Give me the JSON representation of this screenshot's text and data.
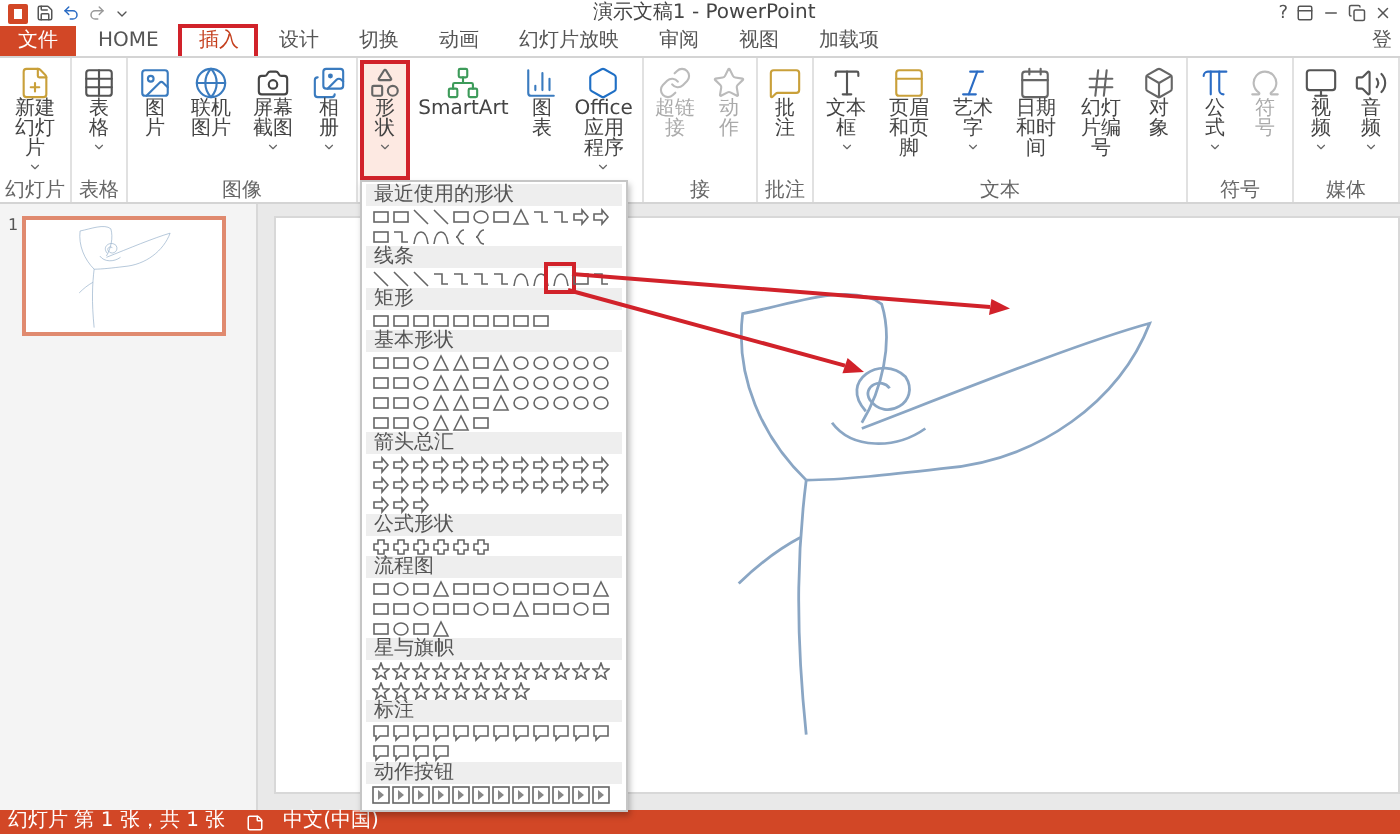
{
  "title_bar": {
    "title": "演示文稿1 - PowerPoint",
    "help": "?"
  },
  "tabs": [
    {
      "label": "文件",
      "kind": "file",
      "selected": false,
      "highlighted": false
    },
    {
      "label": "HOME",
      "kind": "tab",
      "selected": false,
      "highlighted": false
    },
    {
      "label": "插入",
      "kind": "tab",
      "selected": true,
      "highlighted": true
    },
    {
      "label": "设计",
      "kind": "tab",
      "selected": false,
      "highlighted": false
    },
    {
      "label": "切换",
      "kind": "tab",
      "selected": false,
      "highlighted": false
    },
    {
      "label": "动画",
      "kind": "tab",
      "selected": false,
      "highlighted": false
    },
    {
      "label": "幻灯片放映",
      "kind": "tab",
      "selected": false,
      "highlighted": false
    },
    {
      "label": "审阅",
      "kind": "tab",
      "selected": false,
      "highlighted": false
    },
    {
      "label": "视图",
      "kind": "tab",
      "selected": false,
      "highlighted": false
    },
    {
      "label": "加载项",
      "kind": "tab",
      "selected": false,
      "highlighted": false
    }
  ],
  "account": "登",
  "ribbon": [
    {
      "label": "幻灯片",
      "buttons": [
        {
          "label": "新建幻灯片",
          "caret": true,
          "disabled": false,
          "highlighted": false
        }
      ]
    },
    {
      "label": "表格",
      "buttons": [
        {
          "label": "表格",
          "caret": true,
          "disabled": false,
          "highlighted": false
        }
      ]
    },
    {
      "label": "图像",
      "buttons": [
        {
          "label": "图片",
          "caret": false,
          "disabled": false,
          "highlighted": false
        },
        {
          "label": "联机图片",
          "caret": false,
          "disabled": false,
          "highlighted": false
        },
        {
          "label": "屏幕截图",
          "caret": true,
          "disabled": false,
          "highlighted": false
        },
        {
          "label": "相册",
          "caret": true,
          "disabled": false,
          "highlighted": false
        }
      ]
    },
    {
      "buttons": [
        {
          "label": "形状",
          "caret": true,
          "disabled": false,
          "highlighted": true,
          "menu": {
            "sections": [
              {
                "title": "最近使用的形状",
                "kind": "recent",
                "highlighted": false
              },
              {
                "title": "线条",
                "kind": "lines",
                "highlighted": true
              },
              {
                "title": "矩形",
                "kind": "rectangles",
                "highlighted": false
              },
              {
                "title": "基本形状",
                "kind": "basic",
                "highlighted": false
              },
              {
                "title": "箭头总汇",
                "kind": "arrows",
                "highlighted": false
              },
              {
                "title": "公式形状",
                "kind": "equation",
                "highlighted": false
              },
              {
                "title": "流程图",
                "kind": "flowchart",
                "highlighted": false
              },
              {
                "title": "星与旗帜",
                "kind": "stars",
                "highlighted": false
              },
              {
                "title": "标注",
                "kind": "callouts",
                "highlighted": false
              },
              {
                "title": "动作按钮",
                "kind": "actions",
                "highlighted": false
              }
            ]
          }
        },
        {
          "label": "SmartArt",
          "caret": false,
          "disabled": false,
          "highlighted": false
        },
        {
          "label": "图表",
          "caret": false,
          "disabled": false,
          "highlighted": false
        },
        {
          "label": "Office 应用程序",
          "caret": true,
          "disabled": false,
          "highlighted": false
        }
      ]
    },
    {
      "label": "接",
      "buttons": [
        {
          "label": "超链接",
          "caret": false,
          "disabled": true,
          "highlighted": false
        },
        {
          "label": "动作",
          "caret": false,
          "disabled": true,
          "highlighted": false
        }
      ]
    },
    {
      "label": "批注",
      "buttons": [
        {
          "label": "批注",
          "caret": false,
          "disabled": false,
          "highlighted": false
        }
      ]
    },
    {
      "label": "文本",
      "buttons": [
        {
          "label": "文本框",
          "caret": true,
          "disabled": false,
          "highlighted": false
        },
        {
          "label": "页眉和页脚",
          "caret": false,
          "disabled": false,
          "highlighted": false
        },
        {
          "label": "艺术字",
          "caret": true,
          "disabled": false,
          "highlighted": false
        },
        {
          "label": "日期和时间",
          "caret": false,
          "disabled": false,
          "highlighted": false
        },
        {
          "label": "幻灯片编号",
          "caret": false,
          "disabled": false,
          "highlighted": false
        },
        {
          "label": "对象",
          "caret": false,
          "disabled": false,
          "highlighted": false
        }
      ]
    },
    {
      "label": "符号",
      "buttons": [
        {
          "label": "公式",
          "caret": true,
          "disabled": false,
          "highlighted": false
        },
        {
          "label": "符号",
          "caret": false,
          "disabled": true,
          "highlighted": false
        }
      ]
    },
    {
      "label": "媒体",
      "buttons": [
        {
          "label": "视频",
          "caret": true,
          "disabled": false,
          "highlighted": false
        },
        {
          "label": "音频",
          "caret": true,
          "disabled": false,
          "highlighted": false
        }
      ]
    }
  ],
  "slides": [
    {
      "number": "1",
      "selected": true
    }
  ],
  "status_bar": {
    "slide_info": "幻灯片 第 1 张，共 1 张",
    "language": "中文(中国)"
  }
}
